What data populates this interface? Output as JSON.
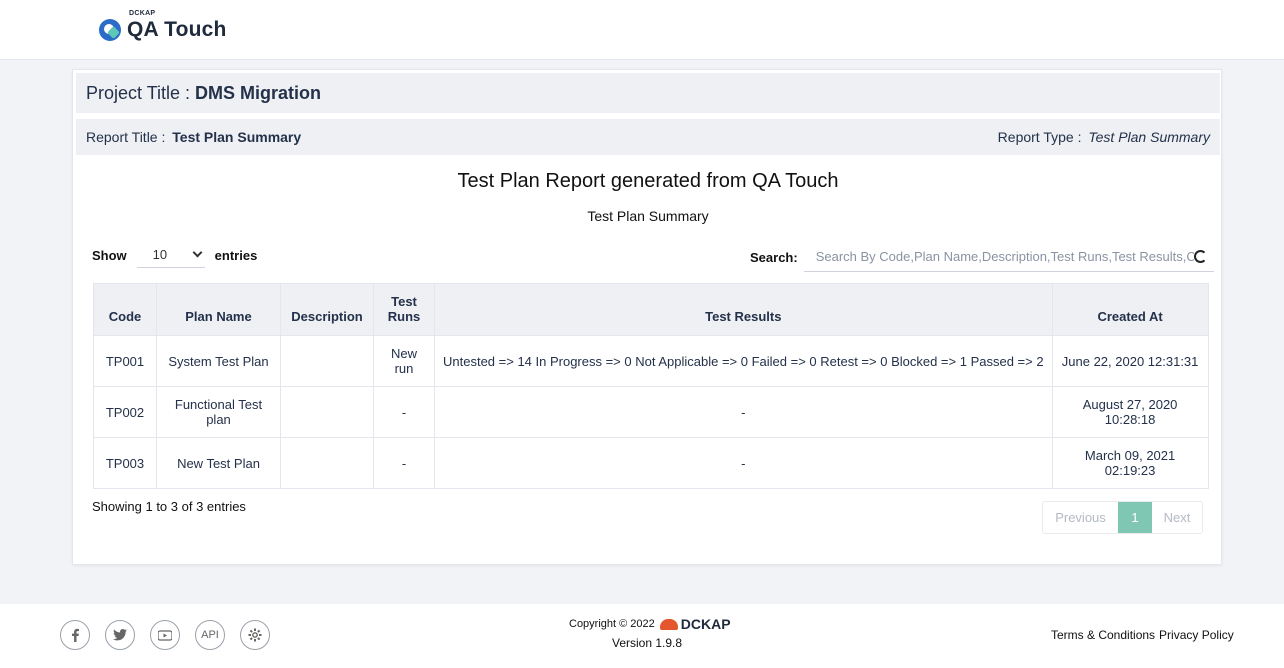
{
  "brand": {
    "small": "DCKAP",
    "name": "QA Touch"
  },
  "project": {
    "label": "Project Title :",
    "value": "DMS Migration"
  },
  "report": {
    "title_label": "Report Title :",
    "title_value": "Test Plan Summary",
    "type_label": "Report Type :",
    "type_value": "Test Plan Summary",
    "heading": "Test Plan Report generated from QA Touch",
    "subheading": "Test Plan Summary"
  },
  "controls": {
    "show_label": "Show",
    "entries_value": "10",
    "entries_label": "entries",
    "search_label": "Search:",
    "search_placeholder": "Search By Code,Plan Name,Description,Test Runs,Test Results,Created At"
  },
  "table": {
    "headers": [
      "Code",
      "Plan Name",
      "Description",
      "Test Runs",
      "Test Results",
      "Created At"
    ],
    "rows": [
      {
        "code": "TP001",
        "plan": "System Test Plan",
        "description": "",
        "runs": "New run",
        "results": "Untested => 14 In Progress => 0 Not Applicable => 0 Failed => 0 Retest => 0 Blocked => 1 Passed => 2",
        "created": "June 22, 2020 12:31:31"
      },
      {
        "code": "TP002",
        "plan": "Functional Test plan",
        "description": "",
        "runs": "-",
        "results": "-",
        "created": "August 27, 2020 10:28:18"
      },
      {
        "code": "TP003",
        "plan": "New Test Plan",
        "description": "",
        "runs": "-",
        "results": "-",
        "created": "March 09, 2021 02:19:23"
      }
    ]
  },
  "pagination": {
    "summary": "Showing 1 to 3 of 3 entries",
    "previous": "Previous",
    "current": "1",
    "next": "Next"
  },
  "footer": {
    "social": [
      "facebook-icon",
      "twitter-icon",
      "youtube-icon",
      "api-icon",
      "settings-icon"
    ],
    "api_label": "API",
    "copyright": "Copyright © 2022",
    "company": "DCKAP",
    "version": "Version 1.9.8",
    "terms": "Terms & Conditions",
    "privacy": "Privacy Policy"
  },
  "colors": {
    "accent": "#7fc7b3",
    "header_bg": "#eef0f4",
    "brand_blue": "#2a6cc8",
    "dckap_orange": "#e4572e"
  }
}
